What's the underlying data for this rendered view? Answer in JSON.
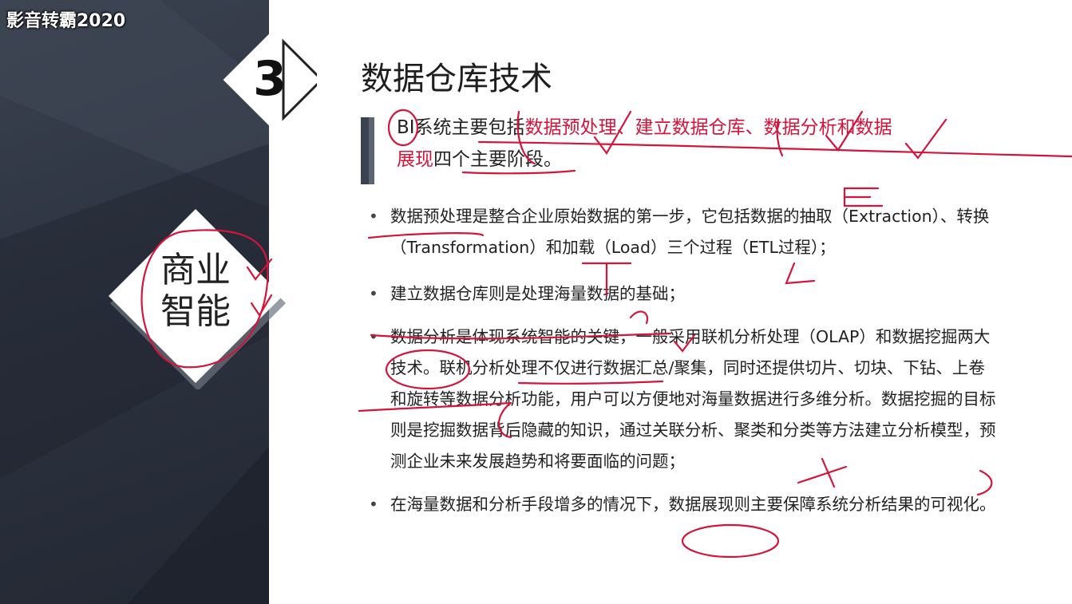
{
  "watermark": "影音转霸2020",
  "section": {
    "number": "3",
    "topic_line1": "商业",
    "topic_line2": "智能"
  },
  "title": "数据仓库技术",
  "intro": {
    "part1": "BI系统主要包括",
    "part2": "数据预处理、建立数据仓库、数据分析和数据",
    "part3": "展现",
    "part4": "四个主要阶段。"
  },
  "bullets": [
    {
      "marker": "•",
      "text": "数据预处理是整合企业原始数据的第一步，它包括数据的抽取（Extraction）、转换（Transformation）和加载（Load）三个过程（ETL过程）；"
    },
    {
      "marker": "•",
      "text": "建立数据仓库则是处理海量数据的基础；"
    },
    {
      "marker": "•",
      "text": "数据分析是体现系统智能的关键，一般采用联机分析处理（OLAP）和数据挖掘两大技术。联机分析处理不仅进行数据汇总/聚集，同时还提供切片、切块、下钻、上卷和旋转等数据分析功能，用户可以方便地对海量数据进行多维分析。数据挖掘的目标则是挖掘数据背后隐藏的知识，通过关联分析、聚类和分类等方法建立分析模型，预测企业未来发展趋势和将要面临的问题；"
    },
    {
      "marker": "•",
      "text": "在海量数据和分析手段增多的情况下，数据展现则主要保障系统分析结果的可视化。"
    }
  ],
  "colors": {
    "highlight": "#d4143b",
    "annotation": "#d4143b",
    "panel": "#2b313d"
  }
}
